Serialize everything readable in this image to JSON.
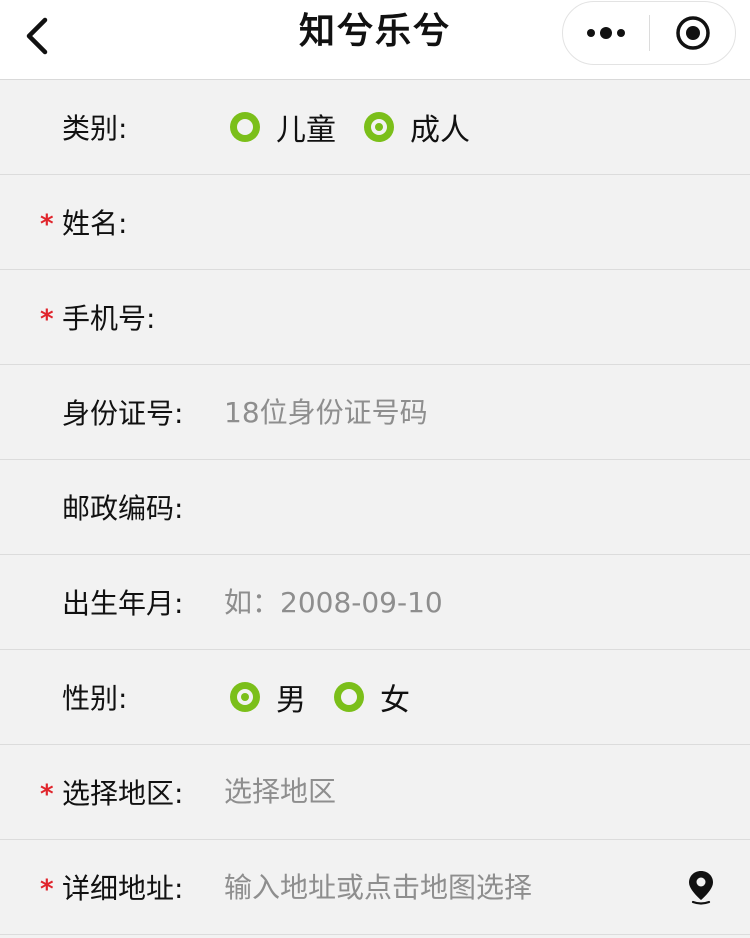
{
  "nav": {
    "title": "知兮乐兮"
  },
  "form": {
    "category": {
      "label": "类别:",
      "options": [
        "儿童",
        "成人"
      ],
      "selected": "成人"
    },
    "name": {
      "label": "姓名:",
      "required": true,
      "value": ""
    },
    "phone": {
      "label": "手机号:",
      "required": true,
      "value": ""
    },
    "id_card": {
      "label": "身份证号:",
      "placeholder": "18位身份证号码"
    },
    "postal_code": {
      "label": "邮政编码:",
      "value": ""
    },
    "birth": {
      "label": "出生年月:",
      "placeholder": "如：2008-09-10"
    },
    "gender": {
      "label": "性别:",
      "options": [
        "男",
        "女"
      ],
      "selected": "男"
    },
    "region": {
      "label": "选择地区:",
      "required": true,
      "placeholder": "选择地区"
    },
    "address": {
      "label": "详细地址:",
      "required": true,
      "placeholder": "输入地址或点击地图选择"
    },
    "required_mark": "*"
  },
  "colors": {
    "accent": "#7bbf1a",
    "required": "#e0242b",
    "placeholder": "#8e8e8e",
    "background": "#f2f2f2"
  },
  "icons": [
    "back-arrow-icon",
    "more-dots-icon",
    "capsule-close-icon",
    "map-pin-icon"
  ]
}
